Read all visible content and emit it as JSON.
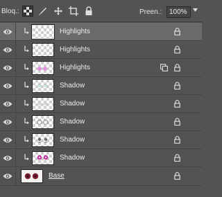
{
  "toolbar": {
    "lock_label": "Bloq.:",
    "fill_label": "Preen.:",
    "fill_value": "100%",
    "icons": [
      "lock-transparent-pixels-icon",
      "lock-image-pixels-icon",
      "lock-position-icon",
      "lock-artboard-icon",
      "lock-all-icon"
    ]
  },
  "layers": [
    {
      "name": "Highlights",
      "clipped": true,
      "selected": true,
      "thumb": "blank",
      "smart_object": false,
      "locked": true
    },
    {
      "name": "Highlights",
      "clipped": true,
      "selected": false,
      "thumb": "blank",
      "smart_object": false,
      "locked": true
    },
    {
      "name": "Highlights",
      "clipped": true,
      "selected": false,
      "thumb": "pink-dots",
      "smart_object": true,
      "locked": true
    },
    {
      "name": "Shadow",
      "clipped": true,
      "selected": false,
      "thumb": "faint-teal",
      "smart_object": false,
      "locked": true
    },
    {
      "name": "Shadow",
      "clipped": true,
      "selected": false,
      "thumb": "faint",
      "smart_object": false,
      "locked": true
    },
    {
      "name": "Shadow",
      "clipped": true,
      "selected": false,
      "thumb": "outline-eyes",
      "smart_object": false,
      "locked": true
    },
    {
      "name": "Shadow",
      "clipped": true,
      "selected": false,
      "thumb": "eyes-dark",
      "smart_object": false,
      "locked": true
    },
    {
      "name": "Shadow",
      "clipped": true,
      "selected": false,
      "thumb": "eyes-magenta",
      "smart_object": false,
      "locked": true
    },
    {
      "name": "Base",
      "clipped": false,
      "selected": false,
      "thumb": "base-eyes",
      "smart_object": false,
      "locked": true
    }
  ],
  "colors": {
    "panel": "#535353",
    "selected_row": "#6a6a6a",
    "text": "#ececec"
  }
}
